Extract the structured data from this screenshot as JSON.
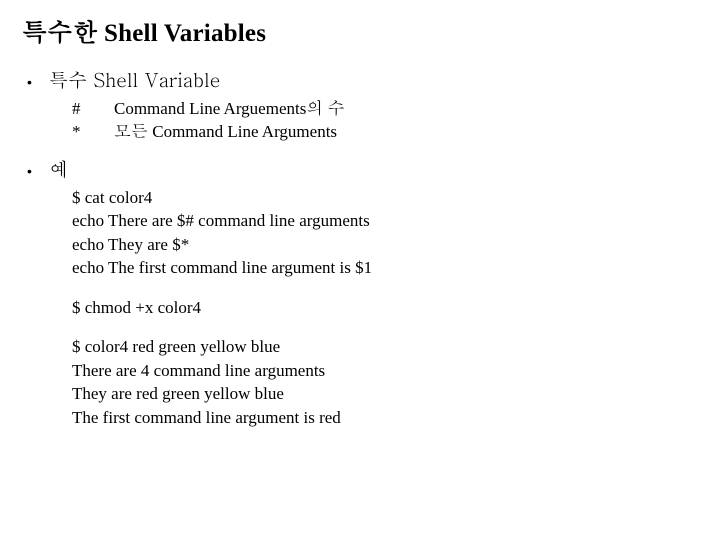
{
  "title": "특수한 Shell Variables",
  "bullets": [
    {
      "label": "특수 Shell Variable"
    },
    {
      "label": "예"
    }
  ],
  "defs": [
    {
      "sym": "#",
      "desc": "Command Line Arguements의 수"
    },
    {
      "sym": "*",
      "desc": "모든 Command Line Arguments"
    }
  ],
  "code": {
    "g1": [
      "$ cat color4",
      "echo There are $# command line arguments",
      "echo They are $*",
      "echo The first command line argument is $1"
    ],
    "g2": [
      "$ chmod +x color4"
    ],
    "g3": [
      "$ color4 red green yellow blue",
      "There are 4 command line arguments",
      "They are red green yellow blue",
      "The first command line argument is red"
    ]
  }
}
